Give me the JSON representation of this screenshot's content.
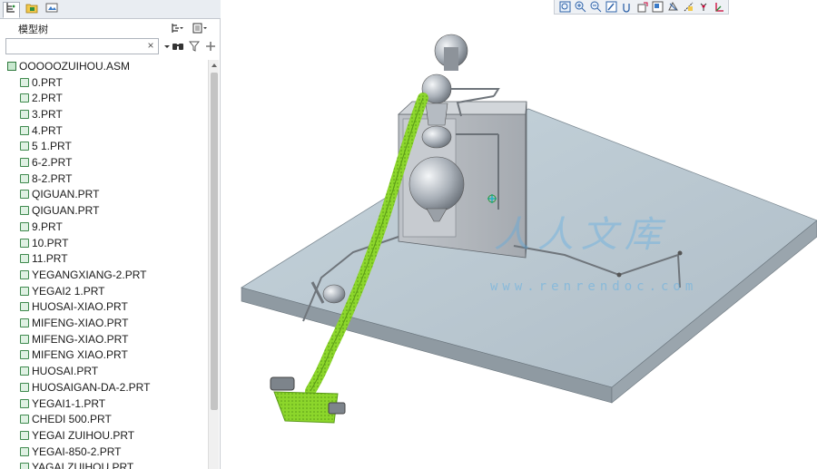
{
  "panel": {
    "tabs": [
      {
        "name": "model-tree-tab",
        "icon": "model-tree-icon"
      },
      {
        "name": "folder-browser-tab",
        "icon": "folder-icon"
      },
      {
        "name": "favorites-tab",
        "icon": "favorites-icon"
      }
    ],
    "tree_title": "模型树",
    "search_placeholder": "",
    "search_clear": "×"
  },
  "tree": {
    "root": "OOOOOZUIHOU.ASM",
    "items": [
      "0.PRT",
      "2.PRT",
      "3.PRT",
      "4.PRT",
      "5  1.PRT",
      "6-2.PRT",
      "8-2.PRT",
      "QIGUAN.PRT",
      "QIGUAN.PRT",
      "9.PRT",
      "10.PRT",
      "11.PRT",
      "YEGANGXIANG-2.PRT",
      "YEGAI2  1.PRT",
      "HUOSAI-XIAO.PRT",
      "MIFENG-XIAO.PRT",
      "MIFENG-XIAO.PRT",
      "MIFENG  XIAO.PRT",
      "HUOSAI.PRT",
      "HUOSAIGAN-DA-2.PRT",
      "YEGAI1-1.PRT",
      "CHEDI 500.PRT",
      "YEGAI  ZUIHOU.PRT",
      "YEGAI-850-2.PRT",
      "YAGAI  ZUIHOU.PRT"
    ]
  },
  "toolbar": {
    "icons": [
      "refit-icon",
      "zoom-in-icon",
      "zoom-out-icon",
      "repaint-icon",
      "spin-center-icon",
      "view-manager-icon",
      "saved-views-icon",
      "datum-planes-icon",
      "datum-axes-icon",
      "datum-points-icon",
      "coordinate-system-icon"
    ]
  },
  "watermark": {
    "text_cn": "人人文库",
    "url": "www.renrendoc.com"
  },
  "colors": {
    "panel_bg": "#ffffff",
    "tab_bar": "#e9edf2",
    "plate_top": "#b9c7d0",
    "highlight": "#8bd62a",
    "part_gray": "#a7acb2"
  }
}
